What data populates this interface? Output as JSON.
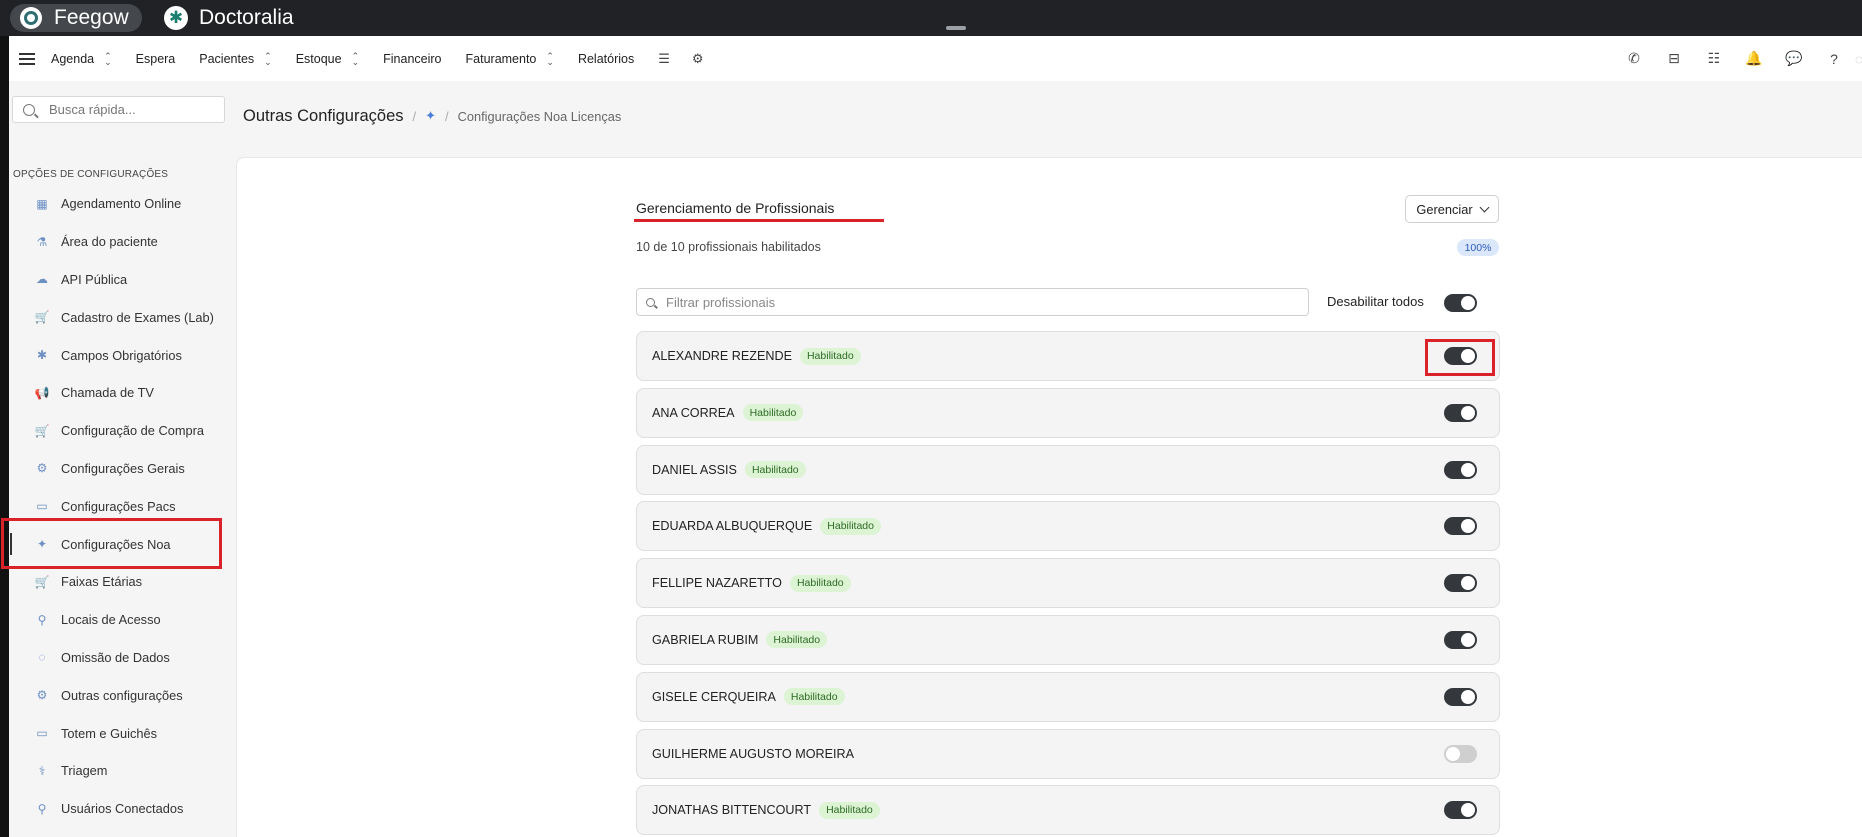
{
  "brands": {
    "feegow": "Feegow",
    "doctoralia": "Doctoralia"
  },
  "nav": {
    "items": [
      {
        "label": "Agenda",
        "dropdown": true
      },
      {
        "label": "Espera",
        "dropdown": false
      },
      {
        "label": "Pacientes",
        "dropdown": true
      },
      {
        "label": "Estoque",
        "dropdown": true
      },
      {
        "label": "Financeiro",
        "dropdown": false
      },
      {
        "label": "Faturamento",
        "dropdown": true
      },
      {
        "label": "Relatórios",
        "dropdown": false
      }
    ],
    "right_icons": [
      "phone-icon",
      "inbox-icon",
      "tasks-icon",
      "bell-icon",
      "chat-icon",
      "help-icon"
    ]
  },
  "sidebar": {
    "search_placeholder": "Busca rápida...",
    "section_title": "OPÇÕES DE CONFIGURAÇÕES",
    "items": [
      {
        "label": "Agendamento Online",
        "icon": "calendar-icon",
        "glyph": "▦"
      },
      {
        "label": "Área do paciente",
        "icon": "flask-icon",
        "glyph": "⚗"
      },
      {
        "label": "API Pública",
        "icon": "cloud-icon",
        "glyph": "☁"
      },
      {
        "label": "Cadastro de Exames (Lab)",
        "icon": "cart-icon",
        "glyph": "🛒"
      },
      {
        "label": "Campos Obrigatórios",
        "icon": "asterisk-icon",
        "glyph": "✱"
      },
      {
        "label": "Chamada de TV",
        "icon": "megaphone-icon",
        "glyph": "📢"
      },
      {
        "label": "Configuração de Compra",
        "icon": "cart-icon",
        "glyph": "🛒"
      },
      {
        "label": "Configurações Gerais",
        "icon": "cogs-icon",
        "glyph": "⚙"
      },
      {
        "label": "Configurações Pacs",
        "icon": "laptop-icon",
        "glyph": "▭"
      },
      {
        "label": "Configurações Noa",
        "icon": "sparkles-icon",
        "glyph": "✦",
        "active": true
      },
      {
        "label": "Faixas Etárias",
        "icon": "cart-icon",
        "glyph": "🛒"
      },
      {
        "label": "Locais de Acesso",
        "icon": "user-icon",
        "glyph": "⚲"
      },
      {
        "label": "Omissão de Dados",
        "icon": "eye-slash-icon",
        "glyph": "◌"
      },
      {
        "label": "Outras configurações",
        "icon": "cogs-icon",
        "glyph": "⚙"
      },
      {
        "label": "Totem e Guichês",
        "icon": "laptop-icon",
        "glyph": "▭"
      },
      {
        "label": "Triagem",
        "icon": "stethoscope-icon",
        "glyph": "⚕"
      },
      {
        "label": "Usuários Conectados",
        "icon": "user-icon",
        "glyph": "⚲"
      }
    ]
  },
  "breadcrumb": {
    "title": "Outras Configurações",
    "current": "Configurações Noa Licenças"
  },
  "panel": {
    "title": "Gerenciamento de Profissionais",
    "manage_label": "Gerenciar",
    "summary": "10 de 10 profissionais habilitados",
    "percent": "100%",
    "filter_placeholder": "Filtrar profissionais",
    "disable_all_label": "Desabilitar todos",
    "disable_all_on": true
  },
  "professionals": [
    {
      "name": "ALEXANDRE REZENDE",
      "status": "Habilitado",
      "enabled": true
    },
    {
      "name": "ANA CORREA",
      "status": "Habilitado",
      "enabled": true
    },
    {
      "name": "DANIEL ASSIS",
      "status": "Habilitado",
      "enabled": true
    },
    {
      "name": "EDUARDA ALBUQUERQUE",
      "status": "Habilitado",
      "enabled": true
    },
    {
      "name": "FELLIPE NAZARETTO",
      "status": "Habilitado",
      "enabled": true
    },
    {
      "name": "GABRIELA RUBIM",
      "status": "Habilitado",
      "enabled": true
    },
    {
      "name": "GISELE CERQUEIRA",
      "status": "Habilitado",
      "enabled": true
    },
    {
      "name": "GUILHERME AUGUSTO MOREIRA",
      "status": "",
      "enabled": false
    },
    {
      "name": "JONATHAS BITTENCOURT",
      "status": "Habilitado",
      "enabled": true
    }
  ],
  "colors": {
    "annotation_red": "#d9222a",
    "toggle_on": "#34383c",
    "badge_green": "#dcf3d4",
    "accent_blue": "#4a7fd6"
  }
}
